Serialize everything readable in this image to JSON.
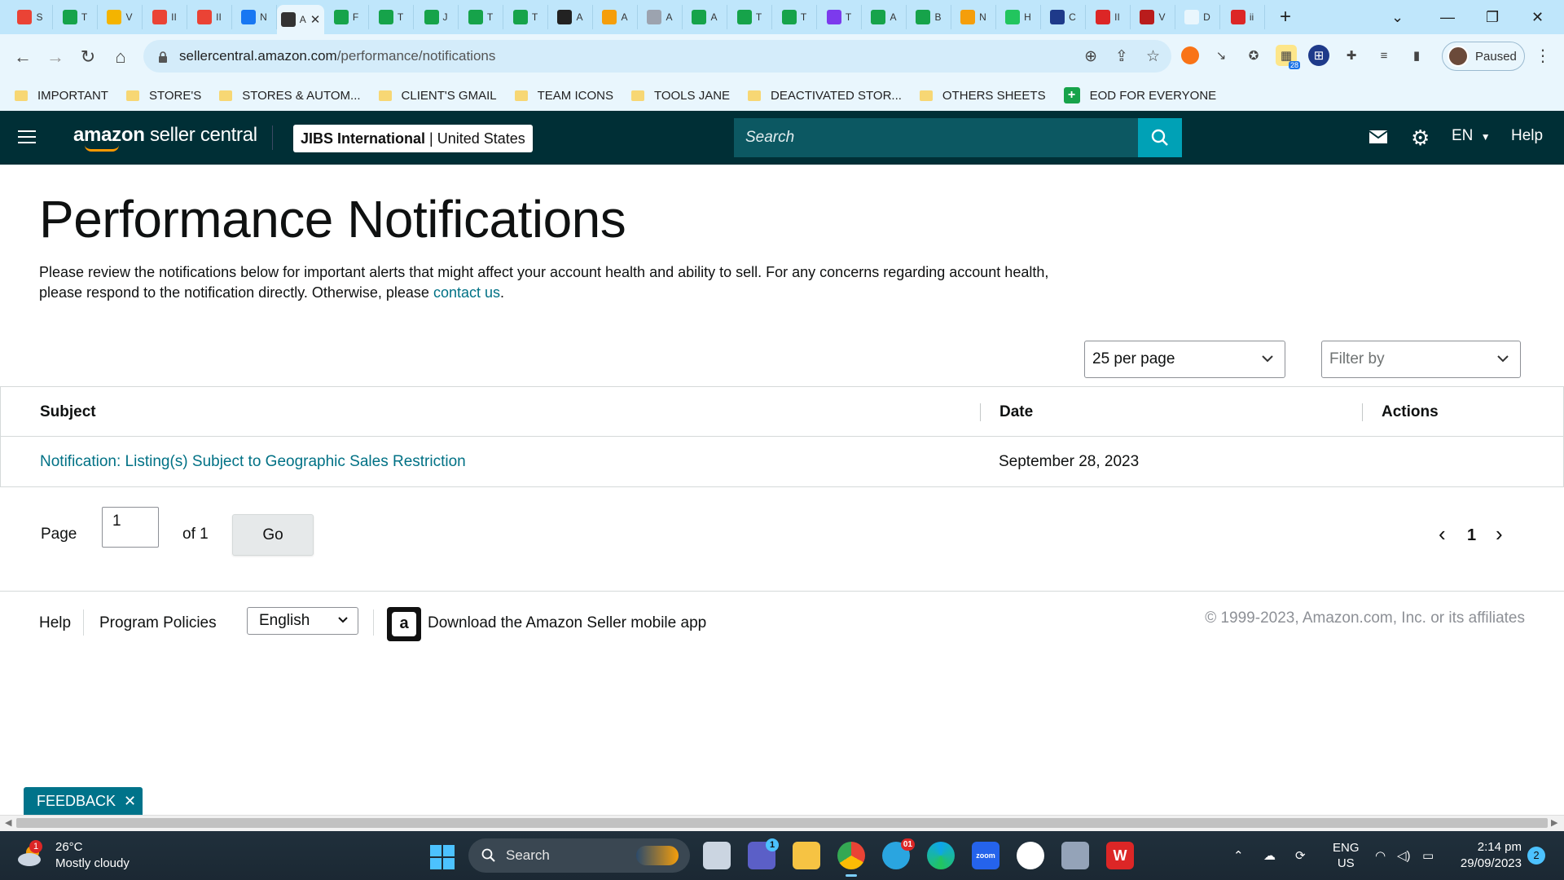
{
  "browser": {
    "tabs": [
      {
        "icon": "gmail-icon",
        "letter": "S",
        "color": "#ea4335"
      },
      {
        "icon": "sheets-icon",
        "letter": "T",
        "color": "#16a34a"
      },
      {
        "icon": "drive-icon",
        "letter": "V",
        "color": "#f4b400"
      },
      {
        "icon": "gmail-icon",
        "letter": "II",
        "color": "#ea4335"
      },
      {
        "icon": "gmail-icon",
        "letter": "II",
        "color": "#ea4335"
      },
      {
        "icon": "facebook-icon",
        "letter": "N",
        "color": "#1877f2"
      },
      {
        "icon": "amazon-icon",
        "letter": "A",
        "color": "#333333",
        "active": true
      },
      {
        "icon": "sheets-icon",
        "letter": "F",
        "color": "#16a34a"
      },
      {
        "icon": "sheets-icon",
        "letter": "T",
        "color": "#16a34a"
      },
      {
        "icon": "sheets-icon",
        "letter": "J",
        "color": "#16a34a"
      },
      {
        "icon": "sheets-icon",
        "letter": "T",
        "color": "#16a34a"
      },
      {
        "icon": "sheets-icon",
        "letter": "T",
        "color": "#16a34a"
      },
      {
        "icon": "circle-icon",
        "letter": "A",
        "color": "#222222"
      },
      {
        "icon": "pen-icon",
        "letter": "A",
        "color": "#f59e0b"
      },
      {
        "icon": "globe-icon",
        "letter": "A",
        "color": "#9ca3af"
      },
      {
        "icon": "sheets-icon",
        "letter": "A",
        "color": "#16a34a"
      },
      {
        "icon": "sheets-icon",
        "letter": "T",
        "color": "#16a34a"
      },
      {
        "icon": "sheets-icon",
        "letter": "T",
        "color": "#16a34a"
      },
      {
        "icon": "chat-icon",
        "letter": "T",
        "color": "#7c3aed"
      },
      {
        "icon": "sheets-icon",
        "letter": "A",
        "color": "#16a34a"
      },
      {
        "icon": "sheets-icon",
        "letter": "B",
        "color": "#16a34a"
      },
      {
        "icon": "grid-icon",
        "letter": "N",
        "color": "#f59e0b"
      },
      {
        "icon": "w-icon",
        "letter": "H",
        "color": "#22c55e"
      },
      {
        "icon": "cloud-icon",
        "letter": "C",
        "color": "#1e3a8a"
      },
      {
        "icon": "vc-icon",
        "letter": "II",
        "color": "#dc2626"
      },
      {
        "icon": "vw-icon",
        "letter": "V",
        "color": "#b91c1c"
      },
      {
        "icon": "doc-icon",
        "letter": "D",
        "color": "#e9f6fd"
      },
      {
        "icon": "shield-icon",
        "letter": "ii",
        "color": "#dc2626"
      }
    ],
    "active_tab_close": "✕",
    "new_tab": "+",
    "url_domain": "sellercentral.amazon.com",
    "url_path": "/performance/notifications",
    "profile_label": "Paused",
    "ext_badge": "28",
    "bookmarks": [
      {
        "label": "IMPORTANT",
        "icon": "folder-icon"
      },
      {
        "label": "STORE'S",
        "icon": "folder-icon"
      },
      {
        "label": "STORES & AUTOM...",
        "icon": "folder-icon"
      },
      {
        "label": "CLIENT'S GMAIL",
        "icon": "folder-icon"
      },
      {
        "label": "TEAM ICONS",
        "icon": "folder-icon"
      },
      {
        "label": "TOOLS JANE",
        "icon": "folder-icon"
      },
      {
        "label": "DEACTIVATED STOR...",
        "icon": "folder-icon"
      },
      {
        "label": "OTHERS SHEETS",
        "icon": "folder-icon"
      },
      {
        "label": "EOD FOR EVERYONE",
        "icon": "sheets-icon"
      }
    ]
  },
  "header": {
    "logo_bold": "amazon",
    "logo_rest": "seller central",
    "account_name": "JIBS International",
    "account_sep": "|",
    "marketplace": "United States",
    "search_placeholder": "Search",
    "language": "EN",
    "help": "Help",
    "bg_color": "#002f36",
    "accent_color": "#00a1b6"
  },
  "page": {
    "title": "Performance Notifications",
    "intro": "Please review the notifications below for important alerts that might affect your account health and ability to sell. For any concerns regarding account health, please respond to the notification directly. Otherwise, please ",
    "intro_link": "contact us",
    "intro_end": ".",
    "per_page": "25 per page",
    "filter_placeholder": "Filter by",
    "columns": {
      "subject": "Subject",
      "date": "Date",
      "actions": "Actions"
    },
    "rows": [
      {
        "subject": "Notification: Listing(s) Subject to Geographic Sales Restriction",
        "date": "September 28, 2023"
      }
    ],
    "pager": {
      "page_label": "Page",
      "page_value": "1",
      "of_label": "of 1",
      "go": "Go",
      "current": "1",
      "prev": "‹",
      "next": "›"
    },
    "link_color": "#007185"
  },
  "footer": {
    "help": "Help",
    "policies": "Program Policies",
    "language": "English",
    "app_text": "Download the Amazon Seller mobile app",
    "app_icon_letter": "a",
    "copyright": "© 1999-2023, Amazon.com, Inc. or its affiliates",
    "feedback": "FEEDBACK",
    "feedback_close": "✕"
  },
  "taskbar": {
    "weather_temp": "26°C",
    "weather_desc": "Mostly cloudy",
    "weather_badge": "1",
    "search_label": "Search",
    "lang_top": "ENG",
    "lang_bottom": "US",
    "time": "2:14 pm",
    "date": "29/09/2023",
    "notifications": "2",
    "teams_badge": "1",
    "telegram_badge": "01"
  }
}
